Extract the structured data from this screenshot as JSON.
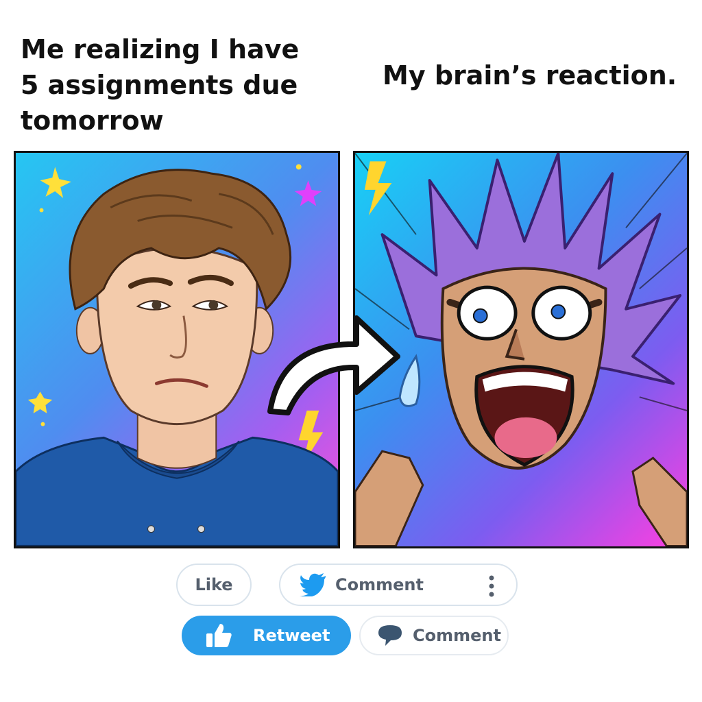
{
  "captions": {
    "left": "Me realizing I have 5 assignments due tomorrow",
    "right": "My brain’s reaction."
  },
  "panels": {
    "left": "calm guy in blue hoodie, worried face",
    "right": "screaming anime character with purple spiky hair"
  },
  "actions": {
    "like_label": "Like",
    "comment_label": "Comment",
    "retweet_label": "Retweet",
    "comment_label_2": "Comment"
  },
  "icons": {
    "comment_top": "twitter-bird-icon",
    "more": "more-vertical-icon",
    "retweet": "thumbs-up-icon",
    "comment_bottom": "speech-bubble-icon"
  },
  "colors": {
    "accent": "#2b9de9",
    "bird": "#1d9bf0",
    "pill_border": "#d9e3ec",
    "pill_text": "#555f6d"
  }
}
